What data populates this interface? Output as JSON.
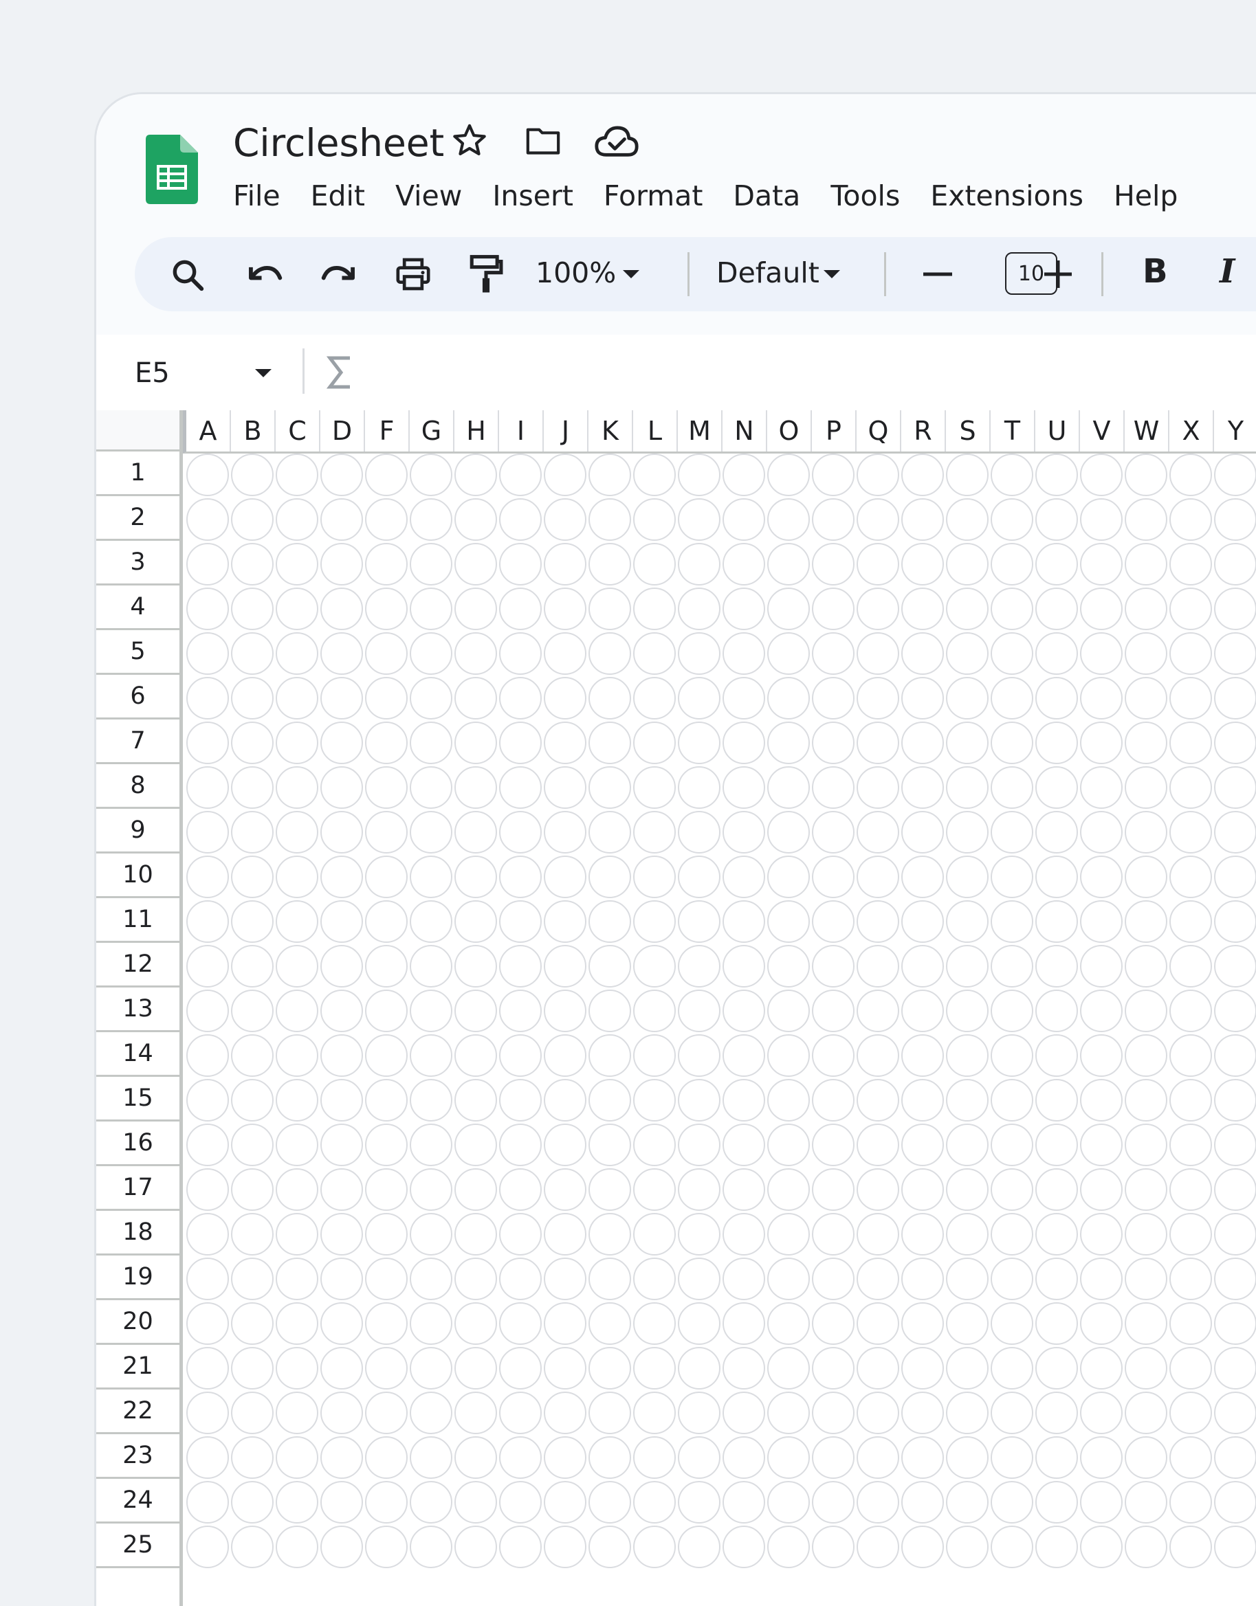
{
  "app": {
    "title": "Circlesheet",
    "accent_color": "#0f9d58",
    "icons": [
      "sheets-logo-icon",
      "star-icon",
      "folder-icon",
      "cloud-done-icon"
    ]
  },
  "menu": [
    "File",
    "Edit",
    "View",
    "Insert",
    "Format",
    "Data",
    "Tools",
    "Extensions",
    "Help"
  ],
  "toolbar": {
    "icons": [
      "search-icon",
      "undo-icon",
      "redo-icon",
      "print-icon",
      "paint-format-icon"
    ],
    "zoom": "100%",
    "font": "Default",
    "font_size": "10",
    "bold_label": "B",
    "italic_label": "I"
  },
  "formula_bar": {
    "name_box": "E5",
    "function_icon": "sigma-icon"
  },
  "sheet": {
    "columns": [
      "A",
      "B",
      "C",
      "D",
      "F",
      "G",
      "H",
      "I",
      "J",
      "K",
      "L",
      "M",
      "N",
      "O",
      "P",
      "Q",
      "R",
      "S",
      "T",
      "U",
      "V",
      "W",
      "X",
      "Y"
    ],
    "rows": [
      "1",
      "2",
      "3",
      "4",
      "5",
      "6",
      "7",
      "8",
      "9",
      "10",
      "11",
      "12",
      "13",
      "14",
      "15",
      "16",
      "17",
      "18",
      "19",
      "20",
      "21",
      "22",
      "23",
      "24",
      "25"
    ]
  }
}
